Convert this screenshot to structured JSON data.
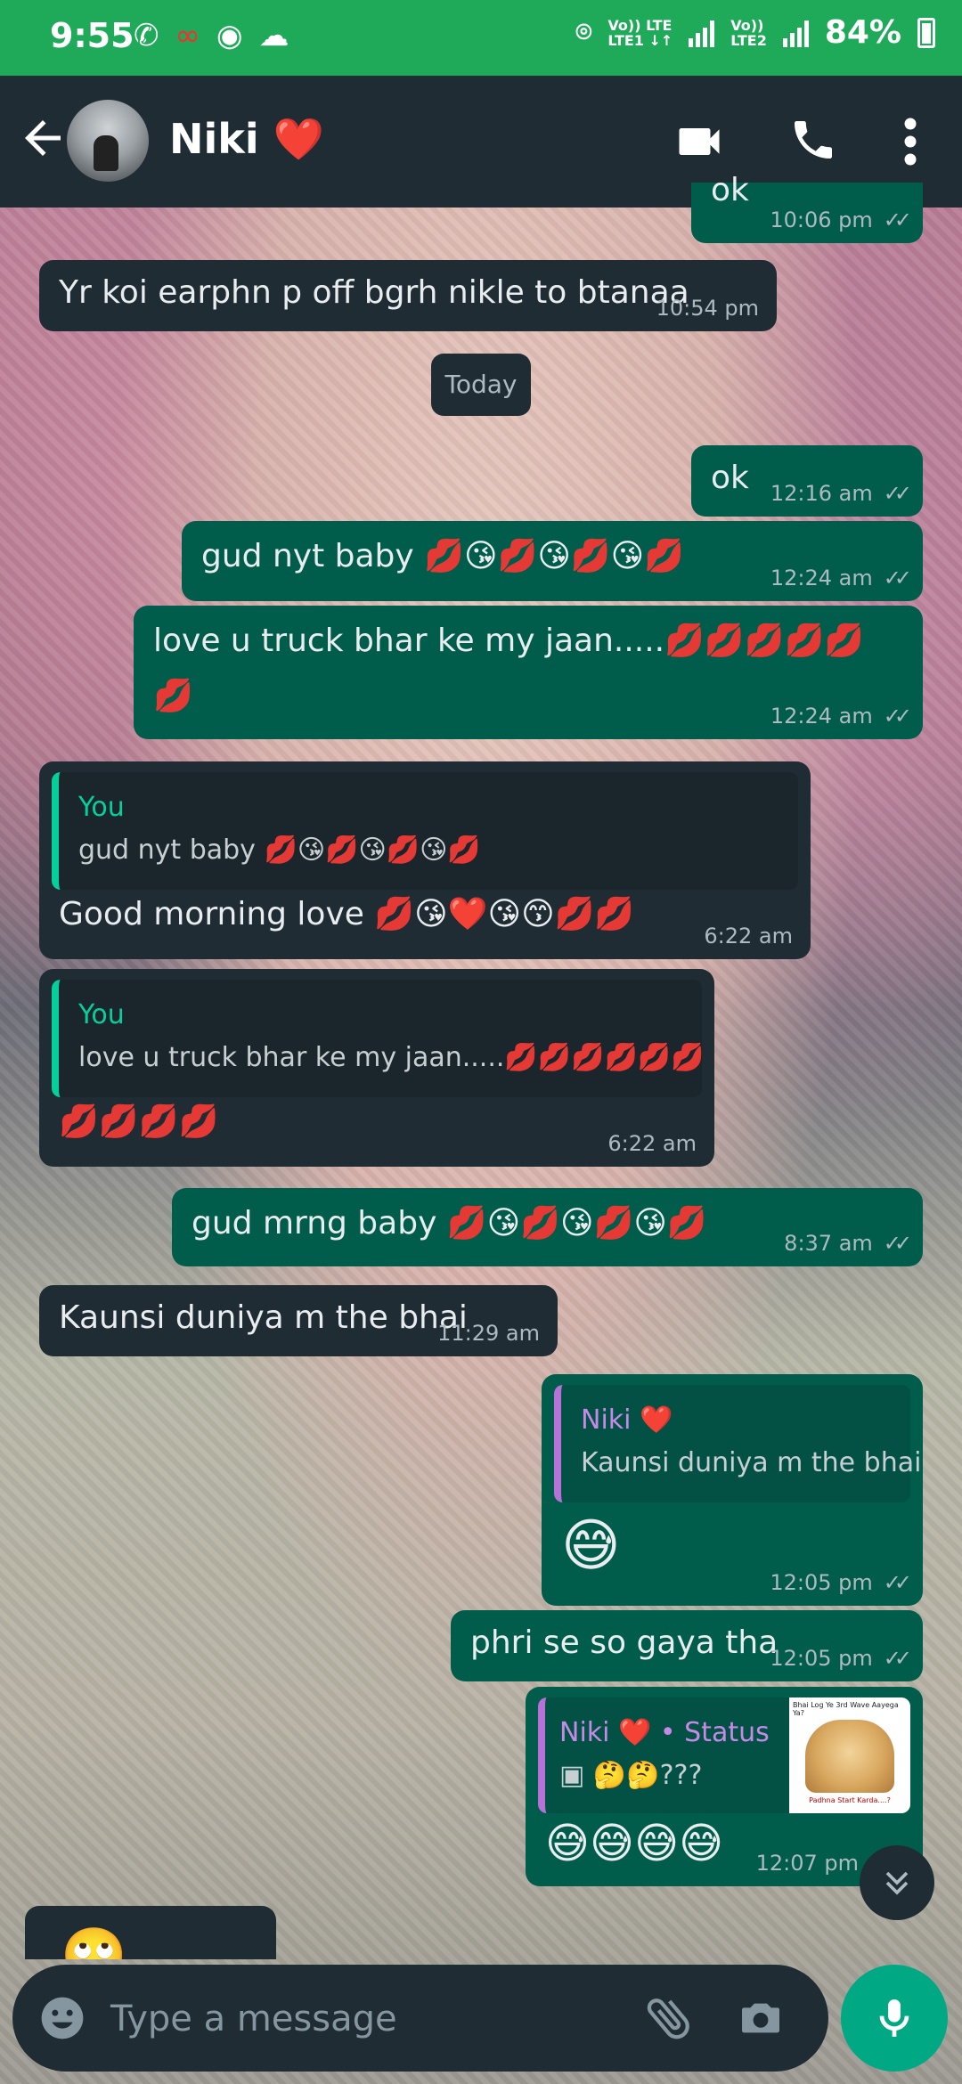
{
  "status_bar": {
    "time": "9:55",
    "network_left": "Vo)) LTE",
    "network_left_sub": "LTE1 ↓↑",
    "network_right": "Vo))",
    "network_right_sub": "LTE2",
    "battery": "84%"
  },
  "header": {
    "contact_name": "Niki ❤️"
  },
  "chat": {
    "messages": [
      {
        "dir": "out",
        "text": "ok",
        "time": "10:06 pm",
        "read": true
      },
      {
        "dir": "in",
        "text": "Yr koi earphn p off bgrh nikle to btanaa",
        "time": "10:54 pm"
      },
      {
        "dir": "day",
        "text": "Today"
      },
      {
        "dir": "out",
        "text": "ok",
        "time": "12:16 am",
        "read": true
      },
      {
        "dir": "out",
        "text": "gud nyt baby 💋😘💋😘💋😘💋",
        "time": "12:24 am",
        "read": true
      },
      {
        "dir": "out",
        "text": "love u truck bhar ke my jaan.....💋💋💋💋💋",
        "text2": "💋",
        "time": "12:24 am",
        "read": true
      },
      {
        "dir": "in",
        "quote_name": "You",
        "quote_text": "gud nyt baby 💋😘💋😘💋😘💋",
        "text": "Good morning love 💋😘❤️😘😙💋💋",
        "time": "6:22 am"
      },
      {
        "dir": "in",
        "quote_name": "You",
        "quote_text": "love u truck bhar ke my jaan.....💋💋💋💋💋💋",
        "text": "💋💋💋💋",
        "time": "6:22 am"
      },
      {
        "dir": "out",
        "text": "gud mrng baby 💋😘💋😘💋😘💋",
        "time": "8:37 am",
        "read": true
      },
      {
        "dir": "in",
        "text": "Kaunsi duniya m the bhai",
        "time": "11:29 am"
      },
      {
        "dir": "out",
        "quote_name": "Niki ❤️",
        "quote_text": "Kaunsi duniya m the bhai",
        "text": "😅",
        "time": "12:05 pm",
        "read": true
      },
      {
        "dir": "out",
        "text": "phri se so gaya tha",
        "time": "12:05 pm",
        "read": true
      },
      {
        "dir": "out",
        "quote_name": "Niki ❤️ • Status",
        "quote_text": "🤔🤔???",
        "status_thumb_title": "Bhai Log Ye 3rd Wave Aayega Ya?",
        "status_thumb_caption": "Padhna Start Karda....?",
        "text": "😅😅😅😅",
        "time": "12:07 pm"
      },
      {
        "dir": "in",
        "text": "🙄"
      }
    ]
  },
  "composer": {
    "placeholder": "Type a message"
  },
  "colors": {
    "status_bar": "#1faa59",
    "header": "#1f2c34",
    "incoming": "#1f2c34",
    "outgoing": "#005c4b",
    "accent": "#00a884"
  }
}
